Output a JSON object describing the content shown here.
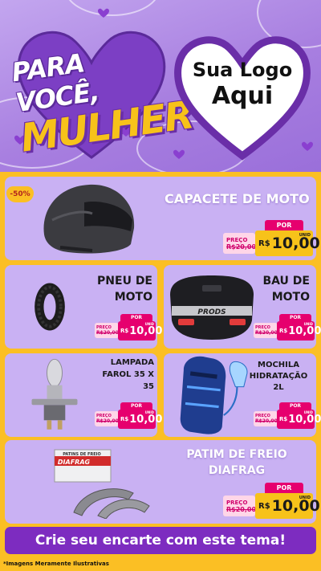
{
  "header": {
    "title_line1": "PARA VOCÊ,",
    "title_line2": "MULHER",
    "logo_line1": "Sua Logo",
    "logo_line2": "Aqui"
  },
  "colors": {
    "purple_bg": "#a87fe0",
    "yellow": "#fbbf24",
    "card": "#c9b1f3",
    "magenta": "#e6006e",
    "cta": "#7d2cc0"
  },
  "products": [
    {
      "name": "CAPACETE DE MOTO",
      "discount": "-50%",
      "old_label": "PREÇO",
      "old_price": "R$20,00",
      "por": "POR",
      "currency": "R$",
      "new_price": "10,00",
      "unit": "UNID",
      "image_icon": "helmet-icon"
    },
    {
      "name_l1": "PNEU DE",
      "name_l2": "MOTO",
      "old_label": "PREÇO",
      "old_price": "R$20,00",
      "por": "POR",
      "currency": "R$",
      "new_price": "10,00",
      "unit": "UNID",
      "image_icon": "tire-icon"
    },
    {
      "name_l1": "BAU DE",
      "name_l2": "MOTO",
      "old_label": "PREÇO",
      "old_price": "R$20,00",
      "por": "POR",
      "currency": "R$",
      "new_price": "10,00",
      "unit": "UNID",
      "image_icon": "top-case-icon",
      "brand": "PRODS"
    },
    {
      "name_l1": "LAMPADA",
      "name_l2": "FAROL 35 X",
      "name_l3": "35",
      "old_label": "PREÇO",
      "old_price": "R$20,00",
      "por": "POR",
      "currency": "R$",
      "new_price": "10,00",
      "unit": "UNID",
      "image_icon": "bulb-icon"
    },
    {
      "name_l1": "MOCHILA",
      "name_l2": "HIDRATAÇÃO",
      "name_l3": "2L",
      "old_label": "PREÇO",
      "old_price": "R$20,00",
      "por": "POR",
      "currency": "R$",
      "new_price": "10,00",
      "unit": "UNID",
      "image_icon": "backpack-icon"
    },
    {
      "name_l1": "PATIM DE FREIO",
      "name_l2": "DIAFRAG",
      "old_label": "PREÇO",
      "old_price": "R$20,00",
      "por": "POR",
      "currency": "R$",
      "new_price": "10,00",
      "unit": "UNID",
      "image_icon": "brake-pads-icon",
      "box_label": "PATINS DE FREIO",
      "box_brand": "DIAFRAG"
    }
  ],
  "cta": "Crie seu encarte com este tema!",
  "footnote": "*Imagens Meramente Ilustrativas"
}
